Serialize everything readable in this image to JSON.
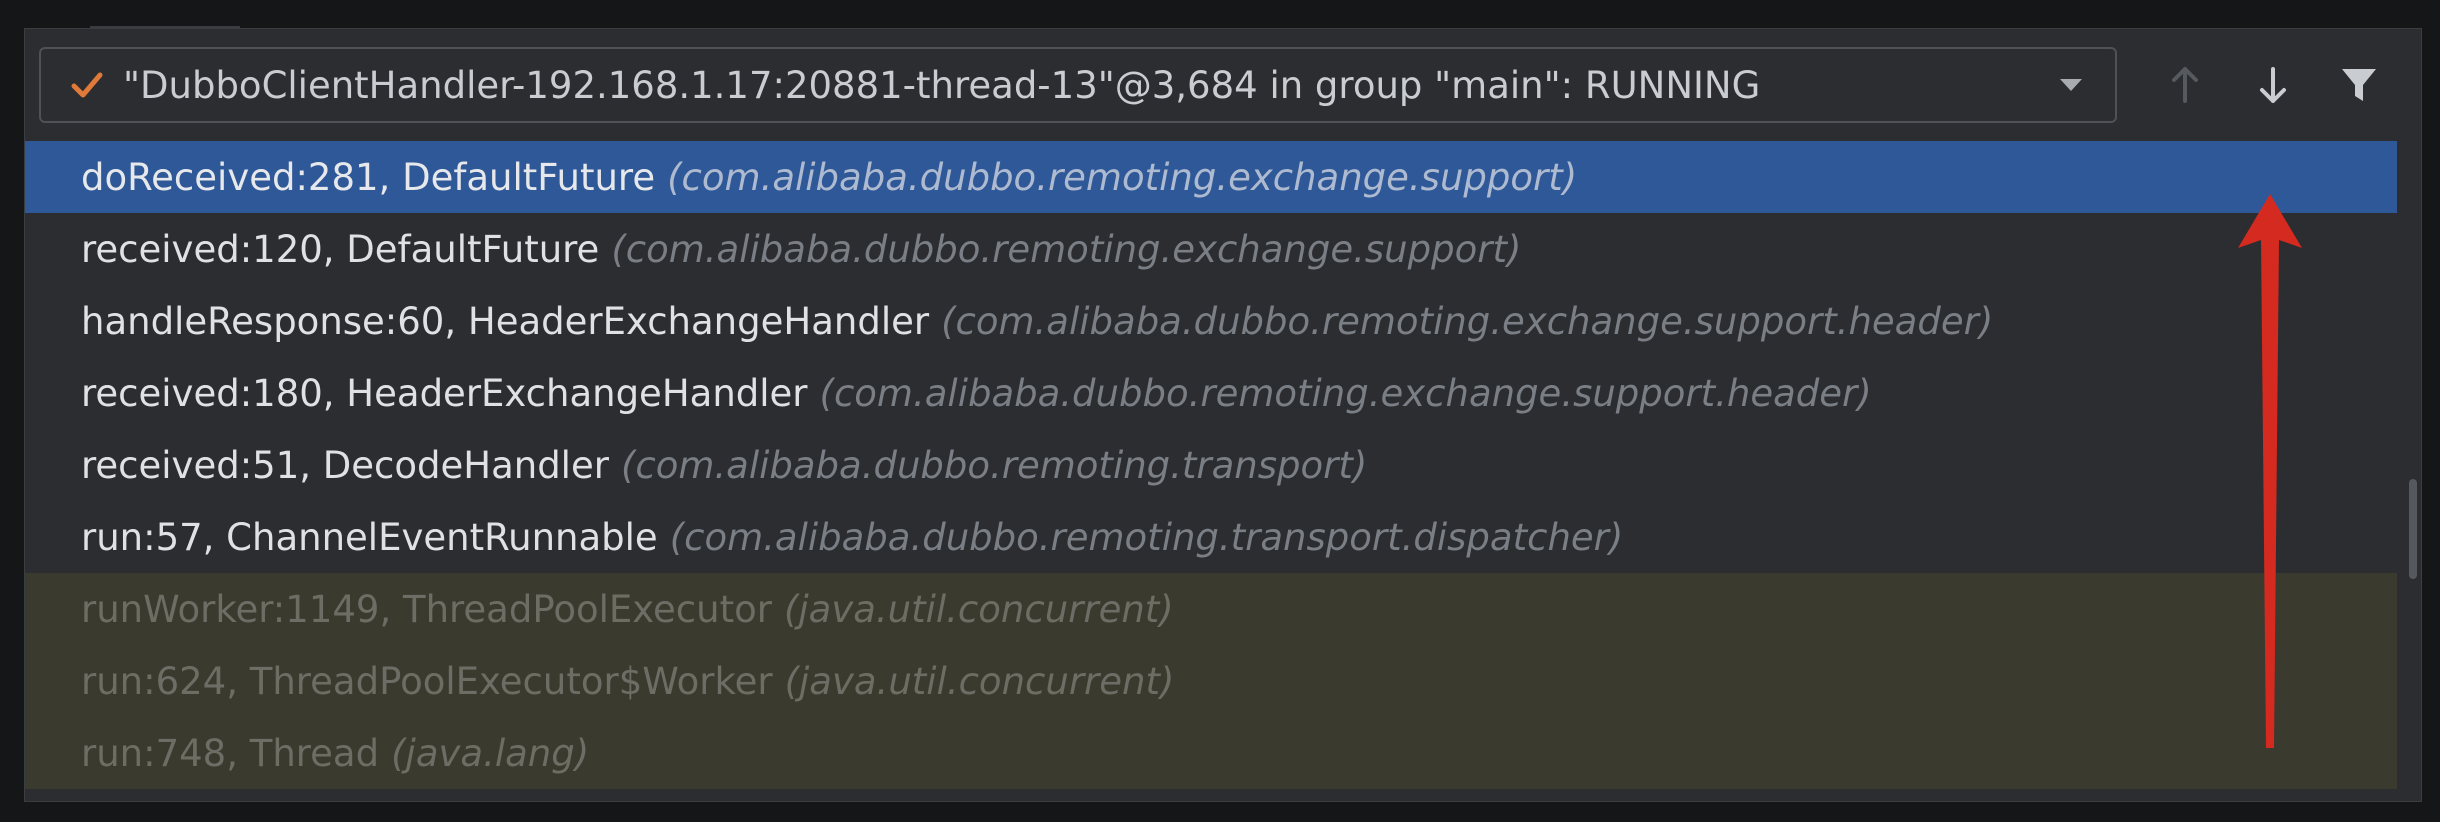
{
  "toolbar": {
    "thread_label": "\"DubboClientHandler-192.168.1.17:20881-thread-13\"@3,684 in group \"main\": RUNNING",
    "check_icon": "check-icon",
    "dropdown_icon": "chevron-down-icon",
    "buttons": [
      {
        "icon": "arrow-up-icon",
        "enabled": false
      },
      {
        "icon": "arrow-down-icon",
        "enabled": true
      },
      {
        "icon": "filter-icon",
        "enabled": true
      }
    ]
  },
  "frames": [
    {
      "method": "doReceived:281, DefaultFuture",
      "package": "(com.alibaba.dubbo.remoting.exchange.support)",
      "selected": true
    },
    {
      "method": "received:120, DefaultFuture",
      "package": "(com.alibaba.dubbo.remoting.exchange.support)"
    },
    {
      "method": "handleResponse:60, HeaderExchangeHandler",
      "package": "(com.alibaba.dubbo.remoting.exchange.support.header)"
    },
    {
      "method": "received:180, HeaderExchangeHandler",
      "package": "(com.alibaba.dubbo.remoting.exchange.support.header)"
    },
    {
      "method": "received:51, DecodeHandler",
      "package": "(com.alibaba.dubbo.remoting.transport)"
    },
    {
      "method": "run:57, ChannelEventRunnable",
      "package": "(com.alibaba.dubbo.remoting.transport.dispatcher)"
    },
    {
      "method": "runWorker:1149, ThreadPoolExecutor",
      "package": "(java.util.concurrent)",
      "library": true
    },
    {
      "method": "run:624, ThreadPoolExecutor$Worker",
      "package": "(java.util.concurrent)",
      "library": true
    },
    {
      "method": "run:748, Thread",
      "package": "(java.lang)",
      "library": true
    }
  ],
  "colors": {
    "selection": "#2e5897",
    "library_background": "#3b3a2e",
    "check_mark": "#e07a3a",
    "annotation_arrow": "#d42a20"
  }
}
